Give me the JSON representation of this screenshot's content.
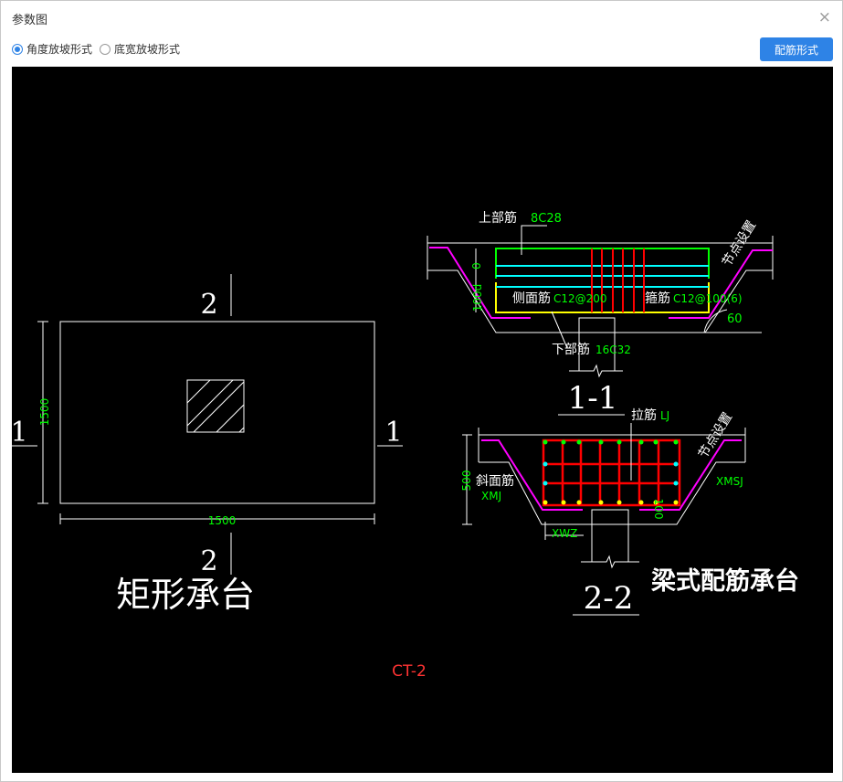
{
  "window": {
    "title": "参数图",
    "close": "×"
  },
  "options": [
    {
      "label": "角度放坡形式",
      "selected": true
    },
    {
      "label": "底宽放坡形式",
      "selected": false
    }
  ],
  "rebar_button": "配筋形式",
  "drawing": {
    "left": {
      "sec2_top": "2",
      "sec2_bottom": "2",
      "sec1_left": "1",
      "sec1_right": "1",
      "dim_h": "1500",
      "dim_w": "1500",
      "title": "矩形承台"
    },
    "s11": {
      "top_label": "上部筋",
      "top_val": "8C28",
      "side_label": "侧面筋",
      "side_val": "C12@200",
      "stir_label": "箍筋",
      "stir_val": "C12@100(6)",
      "bot_label": "下部筋",
      "bot_val": "16C32",
      "angle": "60",
      "node": "节点设置",
      "dim_a": "100d",
      "dim_b": "0",
      "title": "1-1"
    },
    "s22": {
      "tie_label": "拉筋",
      "tie_val": "LJ",
      "slope_label": "斜面筋",
      "slope_val": "XMJ",
      "xwz": "XWZ",
      "xmsj": "XMSJ",
      "dim_h": "500",
      "dim_100": "100",
      "node": "节点设置",
      "title": "2-2",
      "type_title": "梁式配筋承台"
    },
    "code": "CT-2"
  },
  "colors": {
    "accent": "#2e83e6",
    "green": "#00ff00",
    "cyan": "#00ffff",
    "red": "#ff0000",
    "magenta": "#ff00ff",
    "yellow": "#ffff00",
    "code": "#ff3333"
  }
}
